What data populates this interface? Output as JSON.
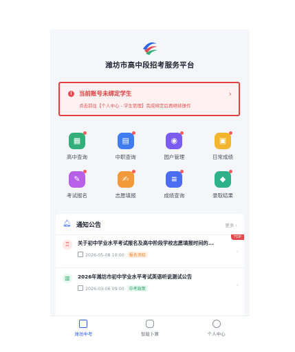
{
  "app": {
    "title": "潍坊市高中段招考服务平台"
  },
  "alert": {
    "title": "当前账号未绑定学生",
    "desc": "点击前往【个人中心 - 学生管理】完成绑定后再继续操作"
  },
  "services": [
    {
      "label": "高中查询",
      "icon": "school-icon",
      "color": "#33b07a"
    },
    {
      "label": "中职查询",
      "icon": "book-icon",
      "color": "#3f7cf0"
    },
    {
      "label": "园户管理",
      "icon": "location-icon",
      "color": "#7a5cf0"
    },
    {
      "label": "日常成绩",
      "icon": "certificate-icon",
      "color": "#f2b52d"
    },
    {
      "label": "考试报名",
      "icon": "signup-icon",
      "color": "#b860e8"
    },
    {
      "label": "志愿填报",
      "icon": "edit-icon",
      "color": "#f29a3a"
    },
    {
      "label": "成绩查询",
      "icon": "document-icon",
      "color": "#4a6df2"
    },
    {
      "label": "录取结果",
      "icon": "graduation-cap-icon",
      "color": "#2fb28a"
    }
  ],
  "notice": {
    "title": "通知公告",
    "more": "更多 ›",
    "items": [
      {
        "title": "关于初中学业水平考试报名及高中阶段学校志愿填报时间的...",
        "date": "2026-05-08 10:00",
        "tag": "报名须知",
        "badge": "TOP"
      },
      {
        "title": "2026年潍坊市初中学业水平考试英语听说测试公告",
        "date": "2026-03-06 09:00",
        "tag": "中考政策"
      }
    ]
  },
  "tabs": [
    {
      "label": "潍坊中考"
    },
    {
      "label": "智能卜算"
    },
    {
      "label": "个人中心"
    }
  ]
}
